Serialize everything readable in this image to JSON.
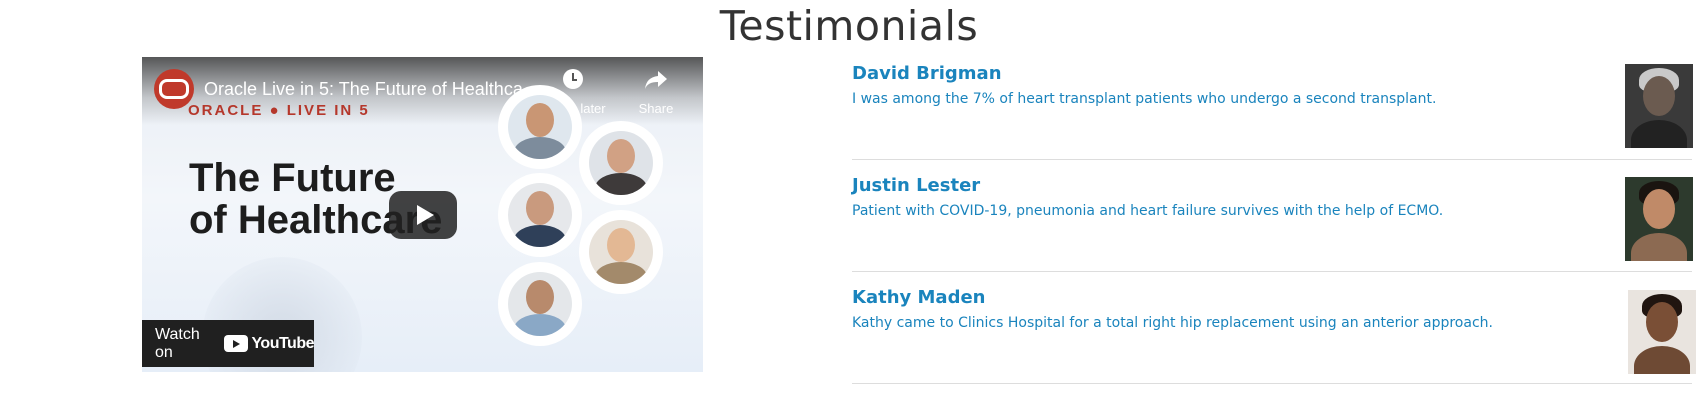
{
  "page": {
    "title": "Testimonials"
  },
  "video": {
    "title": "Oracle Live in 5: The Future of Healthca...",
    "brand": "ORACLE ● LIVE IN 5",
    "headline_line1": "The Future",
    "headline_line2": "of Healthcare",
    "watch_later_label": "Watch later",
    "share_label": "Share",
    "watch_on_label": "Watch on",
    "youtube_label": "YouTube",
    "icons": [
      "oracle-logo-icon",
      "clock-icon",
      "share-arrow-icon",
      "play-icon",
      "youtube-logo-icon"
    ],
    "colors": {
      "brand_red": "#c0392b",
      "player_dark": "#202020"
    }
  },
  "testimonials": [
    {
      "name": "David Brigman",
      "quote": "I was among the 7% of heart transplant patients who undergo a second transplant."
    },
    {
      "name": "Justin Lester",
      "quote": "Patient with COVID-19, pneumonia and heart failure survives with the help of ECMO."
    },
    {
      "name": "Kathy Maden",
      "quote": "Kathy came to Clinics Hospital for a total right hip replacement using an anterior approach."
    }
  ],
  "colors": {
    "link_blue": "#1a84bd",
    "divider": "#dddddd",
    "title_text": "#333333"
  }
}
